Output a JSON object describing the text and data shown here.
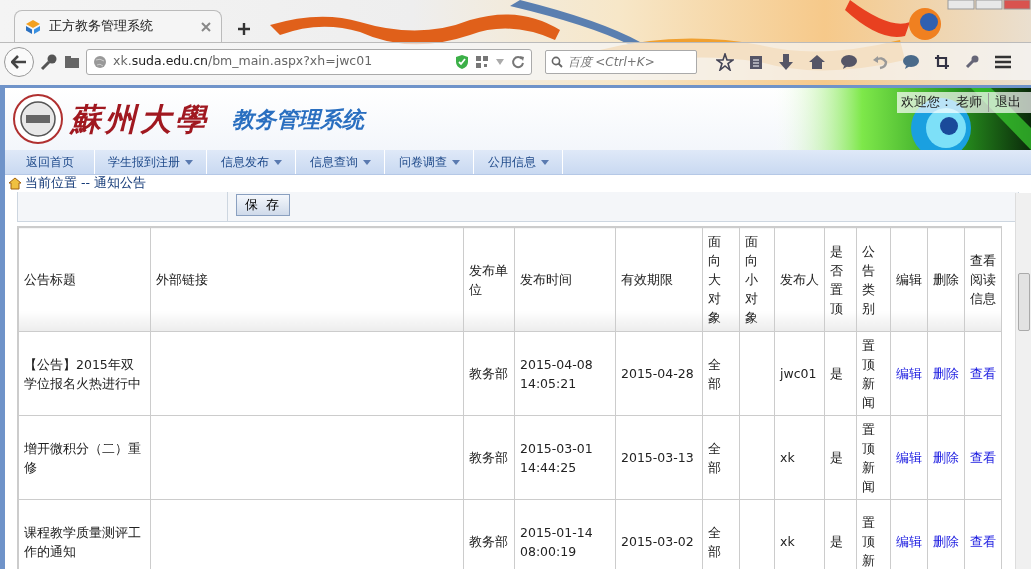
{
  "browser": {
    "tab_title": "正方教务管理系统",
    "url": "xk.**suda.edu.cn**/bm_main.aspx?xh=jwc01",
    "search_placeholder": "百度 <Ctrl+K>"
  },
  "header": {
    "site_name": "蘇州大學",
    "system_title": "教务管理系统",
    "welcome": "欢迎您：",
    "user": "老师",
    "logout": "退出"
  },
  "nav": [
    {
      "label": "返回首页",
      "has_dropdown": false
    },
    {
      "label": "学生报到注册",
      "has_dropdown": true
    },
    {
      "label": "信息发布",
      "has_dropdown": true
    },
    {
      "label": "信息查询",
      "has_dropdown": true
    },
    {
      "label": "问卷调查",
      "has_dropdown": true
    },
    {
      "label": "公用信息",
      "has_dropdown": true
    }
  ],
  "breadcrumb": "当前位置 -- 通知公告",
  "save_button": "保 存",
  "table": {
    "columns": [
      "公告标题",
      "外部链接",
      "发布单位",
      "发布时间",
      "有效期限",
      "面向大对象",
      "面向小对象",
      "发布人",
      "是否置顶",
      "公告类别",
      "编辑",
      "删除",
      "查看阅读信息"
    ],
    "rows": [
      {
        "title": "【公告】2015年双学位报名火热进行中",
        "unit": "教务部",
        "time": "2015-04-08 14:05:21",
        "expiry": "2015-04-28",
        "audience_major": "全部",
        "publisher": "jwc01",
        "pinned": "是",
        "category": "置顶新闻",
        "edit": "编辑",
        "delete": "删除",
        "view": "查看"
      },
      {
        "title": "增开微积分（二）重修",
        "unit": "教务部",
        "time": "2015-03-01 14:44:25",
        "expiry": "2015-03-13",
        "audience_major": "全部",
        "publisher": "xk",
        "pinned": "是",
        "category": "置顶新闻",
        "edit": "编辑",
        "delete": "删除",
        "view": "查看"
      },
      {
        "title": "课程教学质量测评工作的通知",
        "unit": "教务部",
        "time": "2015-01-14 08:00:19",
        "expiry": "2015-03-02",
        "audience_major": "全部",
        "publisher": "xk",
        "pinned": "是",
        "category": "置顶新",
        "edit": "编辑",
        "delete": "删除",
        "view": "查看"
      }
    ]
  }
}
